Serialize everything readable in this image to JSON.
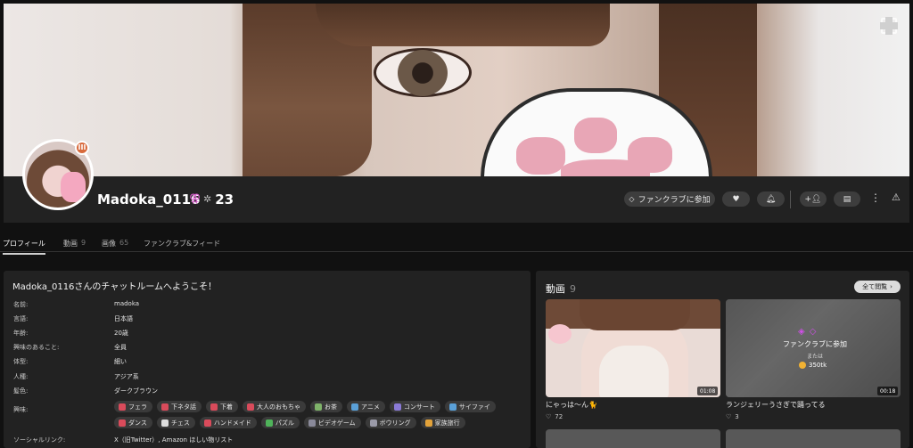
{
  "profile": {
    "username": "Madoka_0116",
    "level": "23",
    "badge": "III",
    "gender_icon": "female-icon"
  },
  "actions": {
    "fanclub_label": "ファンクラブに参加"
  },
  "tabs": [
    {
      "label": "プロフィール",
      "count": ""
    },
    {
      "label": "動画",
      "count": "9"
    },
    {
      "label": "画像",
      "count": "65"
    },
    {
      "label": "ファンクラブ&フィード",
      "count": ""
    }
  ],
  "about": {
    "welcome": "Madoka_0116さんのチャットルームへようこそ！",
    "rows": [
      {
        "label": "名前:",
        "value": "madoka"
      },
      {
        "label": "言語:",
        "value": "日本語"
      },
      {
        "label": "年齢:",
        "value": "20歳"
      },
      {
        "label": "興味のあること:",
        "value": "全員"
      },
      {
        "label": "体型:",
        "value": "細い"
      },
      {
        "label": "人種:",
        "value": "アジア系"
      },
      {
        "label": "髪色:",
        "value": "ダークブラウン"
      }
    ],
    "interests_label": "興味:",
    "interests": [
      {
        "label": "フェラ",
        "color": "#d94b5b"
      },
      {
        "label": "下ネタ話",
        "color": "#d94b5b"
      },
      {
        "label": "下着",
        "color": "#d94b5b"
      },
      {
        "label": "大人のおもちゃ",
        "color": "#d94b5b"
      },
      {
        "label": "お茶",
        "color": "#7fb36a"
      },
      {
        "label": "アニメ",
        "color": "#5aa0d8"
      },
      {
        "label": "コンサート",
        "color": "#8a7ad6"
      },
      {
        "label": "サイファイ",
        "color": "#5aa0d8"
      },
      {
        "label": "ダンス",
        "color": "#d94b5b"
      },
      {
        "label": "チェス",
        "color": "#dddddd"
      },
      {
        "label": "ハンドメイド",
        "color": "#d94b5b"
      },
      {
        "label": "パズル",
        "color": "#4fb35a"
      },
      {
        "label": "ビデオゲーム",
        "color": "#8a8a9a"
      },
      {
        "label": "ボウリング",
        "color": "#9a9aa8"
      },
      {
        "label": "家族旅行",
        "color": "#e2a23a"
      }
    ],
    "social_label": "ソーシャルリンク:",
    "social_value": "X（旧Twitter）, Amazon ほしい物リスト"
  },
  "videos": {
    "title": "動画",
    "count": "9",
    "all_label": "全て閲覧",
    "items": [
      {
        "title": "にゃっは〜ん🐈",
        "duration": "01:08",
        "likes": "72"
      },
      {
        "title": "ランジェリーうさぎで踊ってる",
        "duration": "00:18",
        "likes": "3",
        "locked_label": "ファンクラブに参加",
        "or_label": "または",
        "price": "350tk"
      }
    ]
  }
}
